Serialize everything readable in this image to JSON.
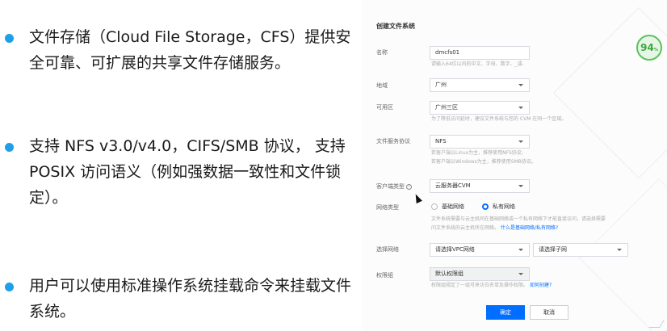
{
  "bullets": [
    {
      "text": "文件存储（Cloud File Storage，CFS）提供安全可靠、可扩展的共享文件存储服务。"
    },
    {
      "text": "支持 NFS v3.0/v4.0，CIFS/SMB 协议， 支持 POSIX 访问语义（例如强数据一致性和文件锁定）。"
    },
    {
      "text": "用户可以使用标准操作系统挂载命令来挂载文件系统。"
    }
  ],
  "form": {
    "title": "创建文件系统",
    "name": {
      "label": "名称",
      "value": "dmcfs01",
      "hint": "请输入64位以内的中文、字母、数字、_或-"
    },
    "region": {
      "label": "地域",
      "value": "广州"
    },
    "zone": {
      "label": "可用区",
      "value": "广州三区",
      "hint": "为了降低访问延时，建议文件系统与您的 CVM 在同一个区域。"
    },
    "protocol": {
      "label": "文件服务协议",
      "value": "NFS",
      "hint1": "若客户端以Linux为主，推荐使用NFS协议;",
      "hint2": "若客户端以Windows为主，推荐使用SMB协议。"
    },
    "client_type": {
      "label": "客户端类型",
      "info_icon": "i",
      "value": "云服务器CVM"
    },
    "network_type": {
      "label": "网络类型",
      "options": [
        "基础网络",
        "私有网络"
      ],
      "selected": "私有网络",
      "hint1": "文件系统需要与云主机同在基础网络或一个私有网络下才能直接访问，请选择需要",
      "hint2": "问文件系统的云主机所在网络。",
      "hint_link": "什么是基础网络/私有网络?"
    },
    "subnet": {
      "label": "选择网络",
      "vpc_value": "请选择VPC网络",
      "subnet_value": "请选择子网"
    },
    "permission": {
      "label": "权限组",
      "value": "默认权限组",
      "hint": "权限组规定了一组可来访白名单及操作权限。",
      "hint_link": "如何创建?"
    },
    "confirm_label": "确定",
    "cancel_label": "取消"
  },
  "badge": {
    "value": "94",
    "unit": "%"
  },
  "colors": {
    "accent": "#006eff",
    "bullet": "#1e9fe8",
    "badge_green": "#58c458"
  }
}
